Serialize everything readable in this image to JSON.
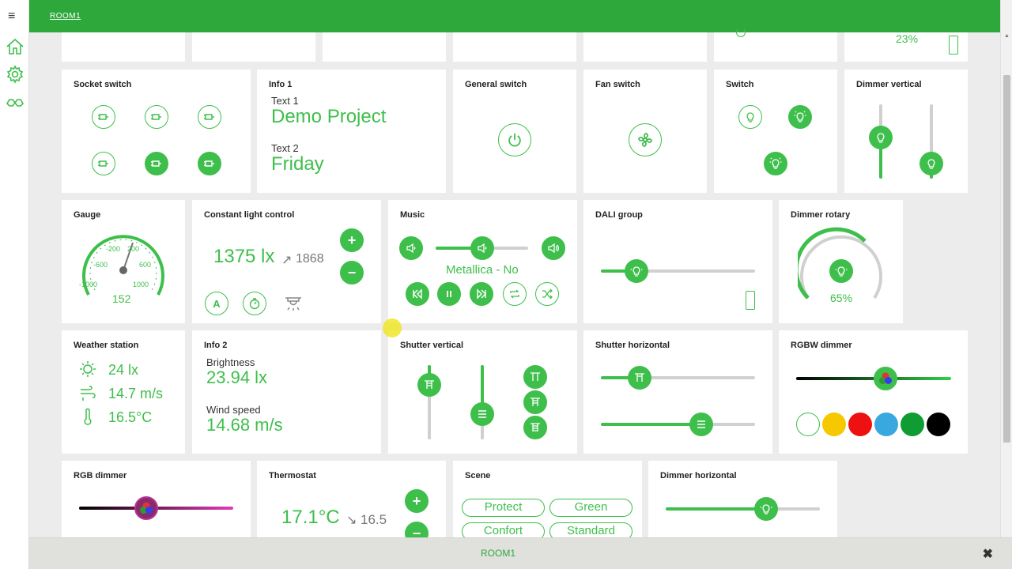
{
  "app": {
    "room_title": "ROOM1",
    "bottom_title": "ROOM1",
    "menu_glyph": "≡",
    "close_glyph": "✖"
  },
  "nav": [
    "home-icon",
    "gear-icon",
    "network-icon"
  ],
  "top_row": {
    "dimmer_value": "23%"
  },
  "socket_switch": {
    "title": "Socket switch"
  },
  "info1": {
    "title": "Info 1",
    "label1": "Text 1",
    "value1": "Demo Project",
    "label2": "Text 2",
    "value2": "Friday"
  },
  "general_switch": {
    "title": "General switch"
  },
  "fan_switch": {
    "title": "Fan switch"
  },
  "switch": {
    "title": "Switch"
  },
  "dimmer_vertical": {
    "title": "Dimmer vertical",
    "levels": [
      0.55,
      0.2
    ]
  },
  "gauge": {
    "title": "Gauge",
    "value": "152",
    "ticks": [
      "-1000",
      "-600",
      "-200",
      "200",
      "600",
      "1000"
    ]
  },
  "constant_light": {
    "title": "Constant light control",
    "value": "1375 lx",
    "setpoint": "1868"
  },
  "music": {
    "title": "Music",
    "track": "Metallica - No",
    "volume": 0.5
  },
  "dali": {
    "title": "DALI group",
    "level": 0.23
  },
  "dimmer_rotary": {
    "title": "Dimmer rotary",
    "value": "65%"
  },
  "weather": {
    "title": "Weather station",
    "brightness": "24 lx",
    "wind": "14.7 m/s",
    "temperature": "16.5°C"
  },
  "info2": {
    "title": "Info 2",
    "label1": "Brightness",
    "value1": "23.94 lx",
    "label2": "Wind speed",
    "value2": "14.68 m/s"
  },
  "shutter_vertical": {
    "title": "Shutter vertical"
  },
  "shutter_horizontal": {
    "title": "Shutter horizontal",
    "level1": 0.25,
    "level2": 0.65
  },
  "rgbw": {
    "title": "RGBW dimmer",
    "colors": [
      "#ffffff",
      "#f5c800",
      "#ee1111",
      "#3aa8e0",
      "#0e9c33",
      "#000000"
    ]
  },
  "rgb": {
    "title": "RGB dimmer"
  },
  "thermostat": {
    "title": "Thermostat",
    "value": "17.1°C",
    "setpoint": "16.5"
  },
  "scene": {
    "title": "Scene",
    "buttons": [
      "Protect",
      "Green",
      "Confort",
      "Standard"
    ]
  },
  "dimmer_horizontal": {
    "title": "Dimmer horizontal",
    "level": 0.65
  }
}
